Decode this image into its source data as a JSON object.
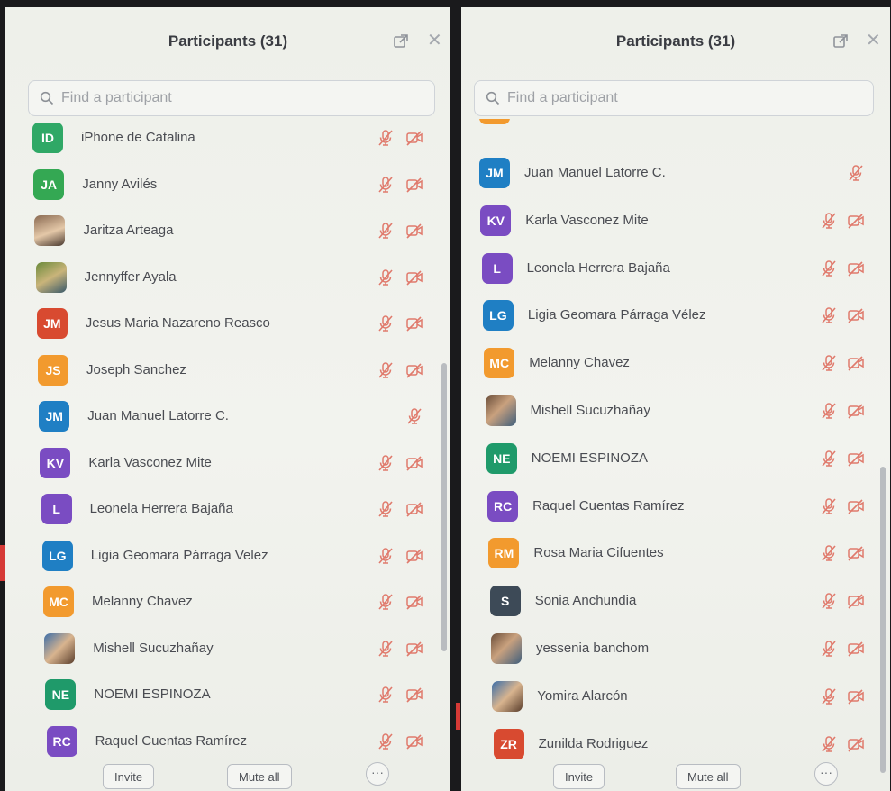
{
  "colors": {
    "panel_bg": "#eff1ec",
    "muted_icon": "#e07a6c",
    "title_text": "#3a3c42"
  },
  "left": {
    "title": "Participants (31)",
    "search_placeholder": "Find a participant",
    "invite_label": "Invite",
    "mute_all_label": "Mute all",
    "more_label": "···",
    "participants": [
      {
        "initials": "ID",
        "name": "iPhone de Catalina",
        "color": "#2fa866",
        "video_off": true
      },
      {
        "initials": "JA",
        "name": "Janny Avilés",
        "color": "#34a853",
        "video_off": true
      },
      {
        "initials": "",
        "name": "Jaritza Arteaga",
        "photo": true,
        "video_off": true
      },
      {
        "initials": "",
        "name": "Jennyffer Ayala",
        "photo": true,
        "video_off": true
      },
      {
        "initials": "JM",
        "name": "Jesus Maria Nazareno Reasco",
        "color": "#d84a30",
        "video_off": true
      },
      {
        "initials": "JS",
        "name": "Joseph Sanchez",
        "color": "#f29a2e",
        "video_off": true
      },
      {
        "initials": "JM",
        "name": "Juan Manuel Latorre C.",
        "color": "#1f7fc4",
        "video_off": false
      },
      {
        "initials": "KV",
        "name": "Karla Vasconez Mite",
        "color": "#7a4cc2",
        "video_off": true
      },
      {
        "initials": "L",
        "name": "Leonela Herrera Bajaña",
        "color": "#7a4cc2",
        "video_off": true
      },
      {
        "initials": "LG",
        "name": "Ligia Geomara Párraga Velez",
        "color": "#1f7fc4",
        "video_off": true
      },
      {
        "initials": "MC",
        "name": "Melanny Chavez",
        "color": "#f29a2e",
        "video_off": true
      },
      {
        "initials": "",
        "name": "Mishell Sucuzhañay",
        "photo": true,
        "video_off": true
      },
      {
        "initials": "NE",
        "name": "NOEMI ESPINOZA",
        "color": "#1f9a6a",
        "video_off": true
      },
      {
        "initials": "RC",
        "name": "Raquel Cuentas Ramírez",
        "color": "#7a4cc2",
        "video_off": true
      }
    ]
  },
  "right": {
    "title": "Participants (31)",
    "search_placeholder": "Find a participant",
    "invite_label": "Invite",
    "mute_all_label": "Mute all",
    "more_label": "···",
    "participants": [
      {
        "initials": "JM",
        "name": "Juan Manuel Latorre C.",
        "color": "#1f7fc4",
        "video_off": false
      },
      {
        "initials": "KV",
        "name": "Karla Vasconez Mite",
        "color": "#7a4cc2",
        "video_off": true
      },
      {
        "initials": "L",
        "name": "Leonela Herrera Bajaña",
        "color": "#7a4cc2",
        "video_off": true
      },
      {
        "initials": "LG",
        "name": "Ligia Geomara Párraga Vélez",
        "color": "#1f7fc4",
        "video_off": true
      },
      {
        "initials": "MC",
        "name": "Melanny Chavez",
        "color": "#f29a2e",
        "video_off": true
      },
      {
        "initials": "",
        "name": "Mishell Sucuzhañay",
        "photo": true,
        "video_off": true
      },
      {
        "initials": "NE",
        "name": "NOEMI ESPINOZA",
        "color": "#1f9a6a",
        "video_off": true
      },
      {
        "initials": "RC",
        "name": "Raquel Cuentas Ramírez",
        "color": "#7a4cc2",
        "video_off": true
      },
      {
        "initials": "RM",
        "name": "Rosa Maria Cifuentes",
        "color": "#f29a2e",
        "video_off": true
      },
      {
        "initials": "S",
        "name": "Sonia Anchundia",
        "color": "#3d4a57",
        "video_off": true
      },
      {
        "initials": "",
        "name": "yessenia banchom",
        "photo": true,
        "video_off": true
      },
      {
        "initials": "",
        "name": "Yomira Alarcón",
        "photo": true,
        "video_off": true
      },
      {
        "initials": "ZR",
        "name": "Zunilda Rodriguez",
        "color": "#d84a30",
        "video_off": true
      }
    ]
  }
}
